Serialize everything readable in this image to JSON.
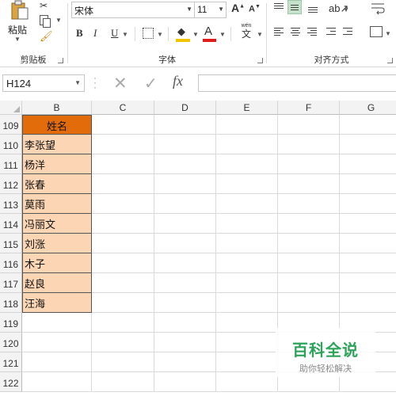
{
  "ribbon": {
    "clipboard": {
      "paste_label": "粘贴",
      "group_label": "剪贴板"
    },
    "font": {
      "group_label": "字体",
      "font_name": "宋体",
      "font_size": "11",
      "bold_label": "B",
      "italic_label": "I",
      "underline_label": "U",
      "font_color_glyph": "A",
      "phonetic_pinyin": "wén",
      "phonetic_char": "文",
      "fill_color": "#f2c400",
      "font_color": "#e01b1b"
    },
    "alignment": {
      "group_label": "对齐方式"
    }
  },
  "formula_bar": {
    "name_box": "H124",
    "fx_label": "fx",
    "formula": ""
  },
  "sheet": {
    "columns": [
      "B",
      "C",
      "D",
      "E",
      "F",
      "G"
    ],
    "rows": [
      "109",
      "110",
      "111",
      "112",
      "113",
      "114",
      "115",
      "116",
      "117",
      "118",
      "119",
      "120",
      "121",
      "122"
    ],
    "header_cell": "姓名",
    "names": [
      "李张望",
      "杨洋",
      "张春",
      "莫雨",
      "冯丽文",
      "刘涨",
      "木子",
      "赵良",
      "汪海"
    ],
    "header_fill": "#e26b0a",
    "name_fill": "#fcd5b4"
  },
  "watermark": {
    "title": "百科全说",
    "subtitle": "助你轻松解决"
  }
}
